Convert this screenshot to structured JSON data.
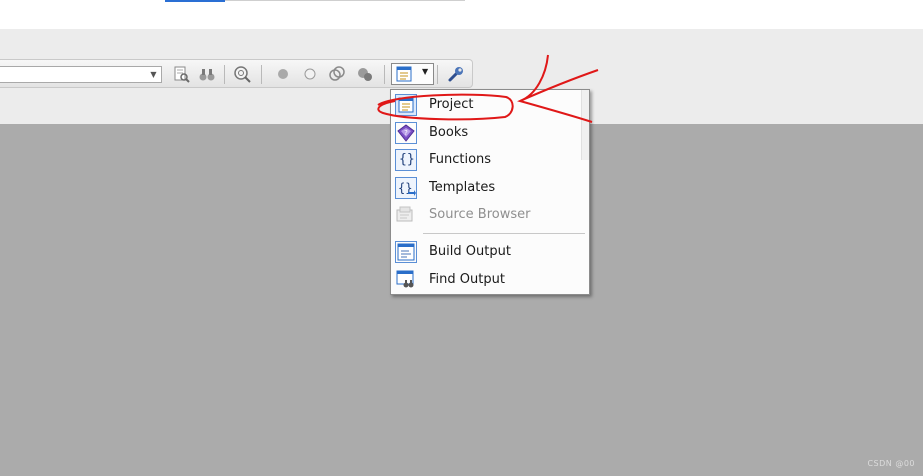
{
  "menu": {
    "items": [
      {
        "label": "Project",
        "icon": "project-window-icon",
        "enabled": true
      },
      {
        "label": "Books",
        "icon": "books-icon",
        "enabled": true
      },
      {
        "label": "Functions",
        "icon": "functions-braces-icon",
        "enabled": true
      },
      {
        "label": "Templates",
        "icon": "templates-icon",
        "enabled": true
      },
      {
        "label": "Source Browser",
        "icon": "source-browser-icon",
        "enabled": false
      },
      {
        "label": "Build Output",
        "icon": "build-output-icon",
        "enabled": true
      },
      {
        "label": "Find Output",
        "icon": "find-output-icon",
        "enabled": true
      }
    ]
  },
  "watermark": "CSDN @00",
  "colors": {
    "annotation": "#e01818",
    "workspace": "#ababab",
    "toolbar": "#ececec",
    "icon_blue": "#2a6ec9",
    "icon_purple": "#7a4fc4"
  }
}
